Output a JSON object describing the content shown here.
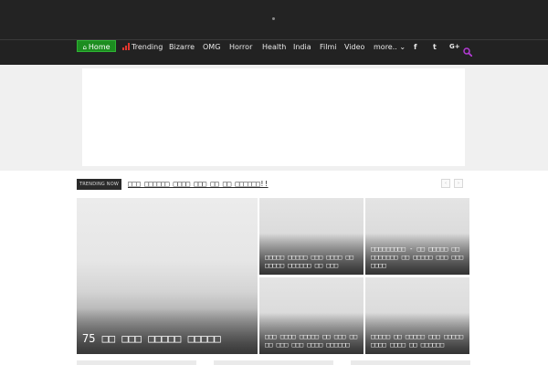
{
  "nav": {
    "home": "Home",
    "trending": "Trending",
    "bizarre": "Bizarre",
    "omg": "OMG",
    "horror": "Horror",
    "health": "Health",
    "india": "India",
    "filmi": "Filmi",
    "video": "Video",
    "more": "more..",
    "more_caret": "⌄"
  },
  "social": {
    "facebook": "f",
    "twitter": "t",
    "googleplus": "G+"
  },
  "trending": {
    "badge": "TRENDING NOW",
    "headline": "□□□ □□□□□□ □□□□ □□□ □□ □□ □□□□□□!!",
    "prev": "‹",
    "next": "›"
  },
  "cards": {
    "main": {
      "title": "75 □□ □□□ □□□□□ □□□□□"
    },
    "c1": {
      "title": "□□□□□ □□□□□ □□□ □□□□ □□ □□□□□ □□□□□□ □□ □□□"
    },
    "c2": {
      "title": "□□□□□□□□□ - □□ □□□□□ □□ □□□□□□□ □□ □□□□□ □□□ □□□ □□□□"
    },
    "c3": {
      "title": "□□□ □□□□ □□□□□ □□ □□□ □□□□ □□□ □□□ □□□□ □□□□□□"
    },
    "c4": {
      "title": "□□□□□ □□ □□□□□ □□□ □□□□□ □□□□ □□□□ □□ □□□□□□"
    }
  },
  "colors": {
    "home_active": "#1c8d20",
    "trending_icon": "#e2362d",
    "search_icon": "#b33bd4"
  }
}
